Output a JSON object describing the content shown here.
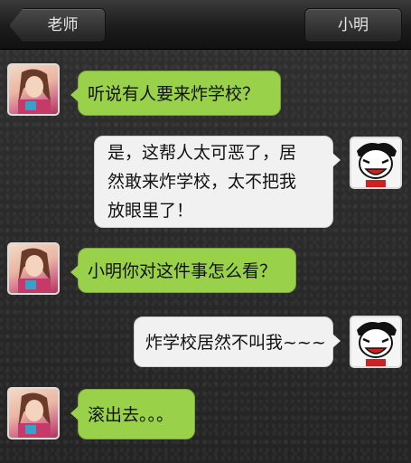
{
  "header": {
    "back_label": "老师",
    "right_label": "小明"
  },
  "messages": [
    {
      "sender": "老师",
      "side": "left",
      "lines": [
        "听说有人要来炸学校？"
      ]
    },
    {
      "sender": "小明",
      "side": "right",
      "lines": [
        "是，这帮人太可恶了，居",
        "然敢来炸学校，太不把我",
        "放眼里了！"
      ]
    },
    {
      "sender": "老师",
      "side": "left",
      "lines": [
        "小明你对这件事怎么看？"
      ]
    },
    {
      "sender": "小明",
      "side": "right",
      "lines": [
        "炸学校居然不叫我~~~"
      ]
    },
    {
      "sender": "老师",
      "side": "left",
      "lines": [
        "滚出去。。。"
      ]
    }
  ],
  "colors": {
    "left_bubble": "#9ad14b",
    "right_bubble": "#f1f1f1"
  },
  "icons": {
    "teacher_avatar": "girl-avatar-icon",
    "xiaoming_avatar": "cartoon-boy-avatar-icon"
  }
}
